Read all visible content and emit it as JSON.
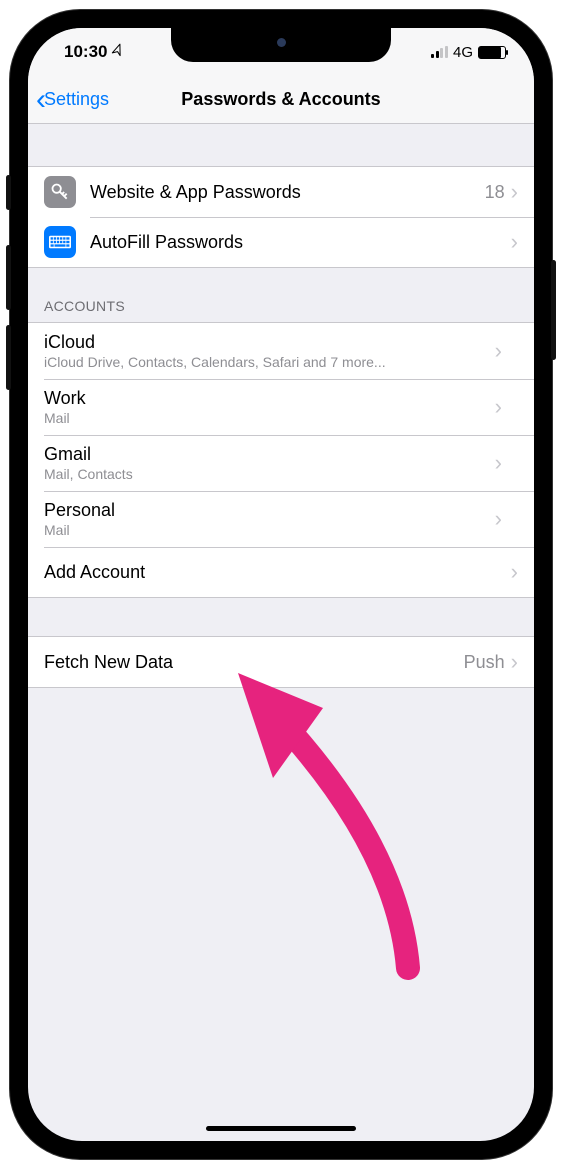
{
  "status_bar": {
    "time": "10:30",
    "location_glyph": "➤",
    "network_label": "4G"
  },
  "nav": {
    "back_label": "Settings",
    "title": "Passwords & Accounts"
  },
  "passwords_section": {
    "website_passwords": {
      "label": "Website & App Passwords",
      "count": "18"
    },
    "autofill": {
      "label": "AutoFill Passwords"
    }
  },
  "accounts_header": "Accounts",
  "accounts": [
    {
      "name": "iCloud",
      "detail": "iCloud Drive, Contacts, Calendars, Safari and 7 more..."
    },
    {
      "name": "Work",
      "detail": "Mail"
    },
    {
      "name": "Gmail",
      "detail": "Mail, Contacts"
    },
    {
      "name": "Personal",
      "detail": "Mail"
    }
  ],
  "add_account_label": "Add Account",
  "fetch": {
    "label": "Fetch New Data",
    "value": "Push"
  }
}
